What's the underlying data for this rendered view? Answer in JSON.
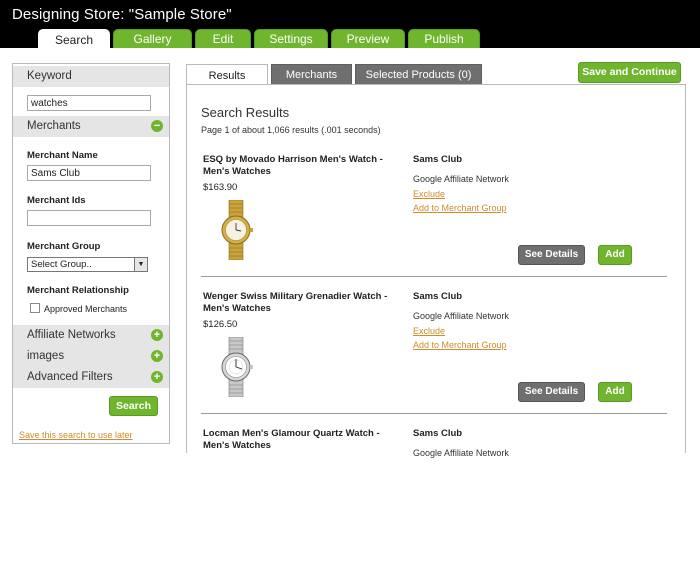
{
  "header": {
    "title": "Designing Store: \"Sample Store\"",
    "tabs": [
      {
        "label": "Search",
        "active": true
      },
      {
        "label": "Gallery"
      },
      {
        "label": "Edit"
      },
      {
        "label": "Settings"
      },
      {
        "label": "Preview"
      },
      {
        "label": "Publish"
      }
    ]
  },
  "sidebar": {
    "keyword_label": "Keyword",
    "keyword_value": "watches",
    "merchants_label": "Merchants",
    "merchant_name_label": "Merchant Name",
    "merchant_name_value": "Sams Club",
    "merchant_ids_label": "Merchant Ids",
    "merchant_ids_value": "",
    "merchant_group_label": "Merchant Group",
    "merchant_group_selected": "Select Group..",
    "merchant_relationship_label": "Merchant Relationship",
    "approved_merchants_label": "Approved Merchants",
    "affiliate_networks_label": "Affiliate Networks",
    "images_label": "images",
    "advanced_filters_label": "Advanced Filters",
    "search_button": "Search",
    "save_search_link": "Save this search to use later"
  },
  "main": {
    "save_continue_button": "Save and Continue",
    "tabs": [
      {
        "label": "Results",
        "active": true
      },
      {
        "label": "Merchants"
      },
      {
        "label": "Selected Products (0)"
      }
    ],
    "results_title": "Search Results",
    "results_summary": "Page 1 of about 1,066 results (.001 seconds)",
    "products": [
      {
        "name": "ESQ by Movado Harrison Men's Watch - Men's Watches",
        "price": "$163.90",
        "merchant": "Sams Club",
        "network": "Google Affiliate Network",
        "exclude": "Exclude",
        "add_group": "Add to Merchant Group",
        "details_button": "See Details",
        "add_button": "Add",
        "image_icon": "gold-watch-icon"
      },
      {
        "name": "Wenger Swiss Military Grenadier Watch - Men's Watches",
        "price": "$126.50",
        "merchant": "Sams Club",
        "network": "Google Affiliate Network",
        "exclude": "Exclude",
        "add_group": "Add to Merchant Group",
        "details_button": "See Details",
        "add_button": "Add",
        "image_icon": "silver-watch-icon"
      },
      {
        "name": "Locman Men's Glamour Quartz Watch - Men's Watches",
        "merchant": "Sams Club",
        "network": "Google Affiliate Network"
      }
    ]
  },
  "colors": {
    "accent_green": "#6fb52e",
    "tab_gray": "#6f6f6f",
    "link_orange": "#d08b2a"
  }
}
